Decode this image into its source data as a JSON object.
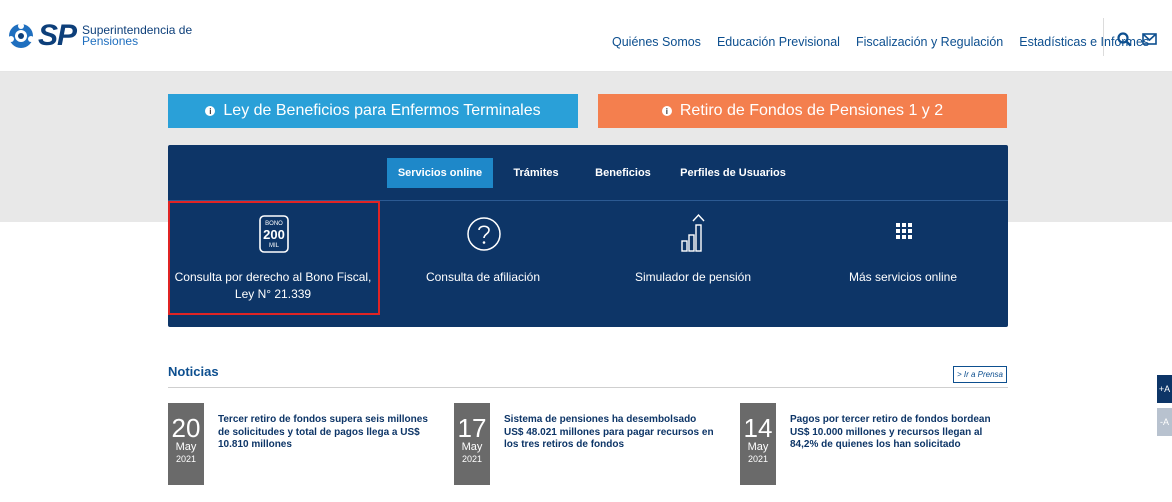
{
  "header": {
    "logo_mark": "SP",
    "logo_line1": "Superintendencia de",
    "logo_line2": "Pensiones",
    "nav": [
      {
        "label": "Quiénes Somos"
      },
      {
        "label": "Educación Previsional"
      },
      {
        "label": "Fiscalización y Regulación"
      },
      {
        "label": "Estadísticas e Informes"
      }
    ]
  },
  "banners": {
    "left": {
      "label": "Ley de Beneficios para Enfermos Terminales",
      "color": "#2aa0d8"
    },
    "right": {
      "label": "Retiro de Fondos de Pensiones 1 y 2",
      "color": "#f47f4e"
    }
  },
  "services": {
    "tabs": [
      {
        "label": "Servicios online",
        "active": true
      },
      {
        "label": "Trámites"
      },
      {
        "label": "Beneficios"
      },
      {
        "label": "Perfiles de Usuarios"
      }
    ],
    "bono_badge": {
      "top": "BONO",
      "mid": "200",
      "bottom": "MIL"
    },
    "items": [
      {
        "label": "Consulta por derecho al Bono Fiscal, Ley N° 21.339",
        "icon": "bono-200-mil-icon"
      },
      {
        "label": "Consulta de afiliación",
        "icon": "question-circle-icon"
      },
      {
        "label": "Simulador de pensión",
        "icon": "bar-chart-up-icon"
      },
      {
        "label": "Más servicios online",
        "icon": "grid-icon"
      }
    ]
  },
  "news": {
    "title": "Noticias",
    "more_link": "> Ir a Prensa",
    "items": [
      {
        "day": "20",
        "month": "May",
        "year": "2021",
        "text": "Tercer retiro de fondos supera seis millones de solicitudes y total de pagos llega a US$ 10.810 millones"
      },
      {
        "day": "17",
        "month": "May",
        "year": "2021",
        "text": "Sistema de pensiones ha desembolsado US$ 48.021 millones para pagar recursos en los tres retiros de fondos"
      },
      {
        "day": "14",
        "month": "May",
        "year": "2021",
        "text": "Pagos por tercer retiro de fondos bordean US$ 10.000 millones y recursos llegan al 84,2% de quienes los han solicitado"
      }
    ]
  },
  "side_buttons": [
    {
      "label": "+A"
    },
    {
      "label": "-A"
    }
  ],
  "colors": {
    "primary": "#0d3567",
    "accent": "#1e88c9",
    "highlight": "#e02424"
  }
}
